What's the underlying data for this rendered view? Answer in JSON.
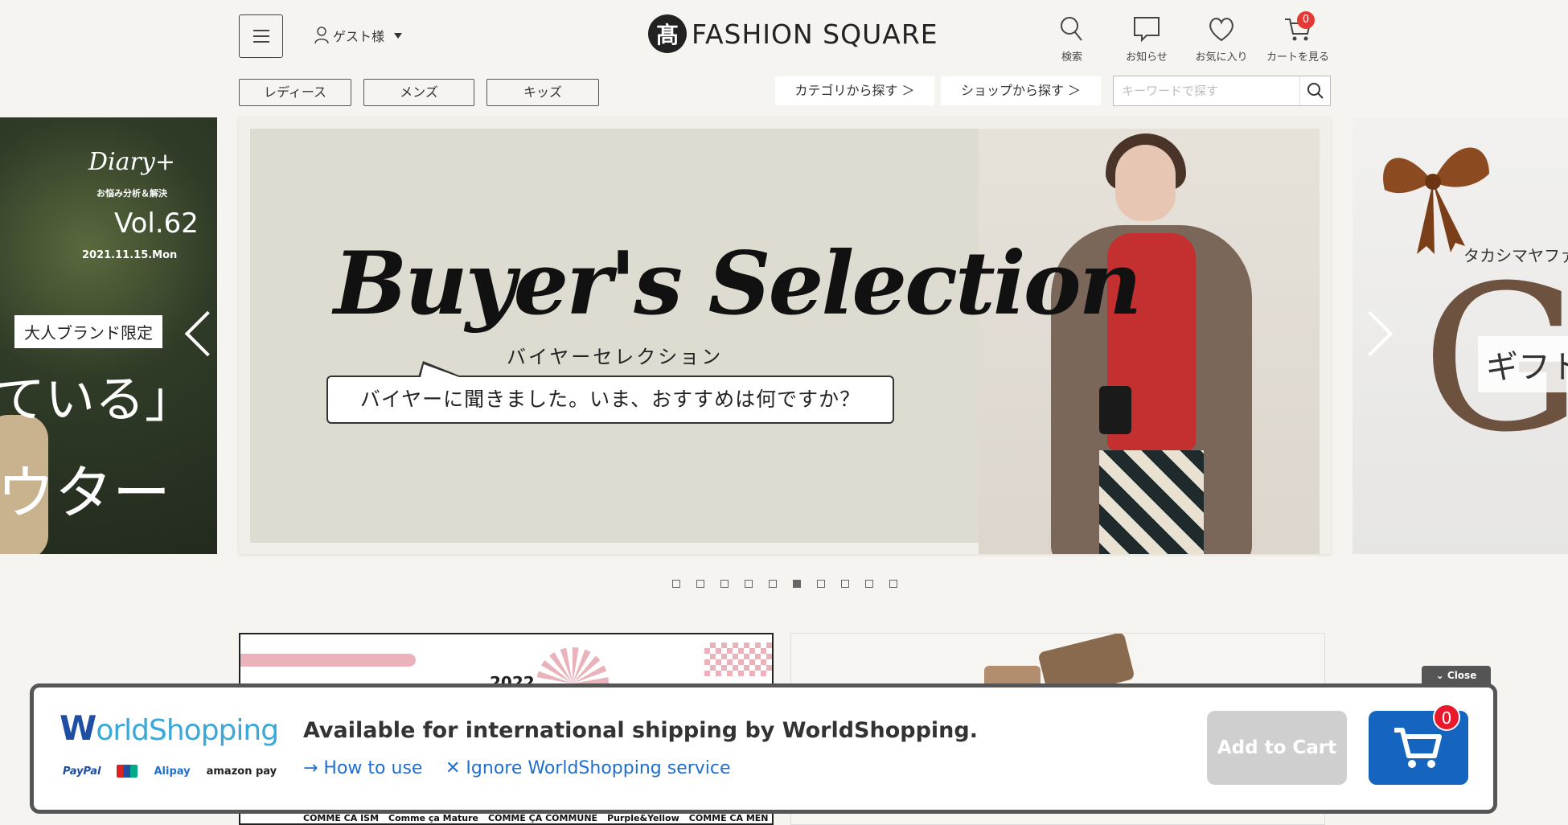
{
  "header": {
    "guest_label": "ゲスト様",
    "logo_mark": "髙",
    "logo_text": "FASHION SQUARE",
    "icons": [
      {
        "label": "検索",
        "icon": "search-icon"
      },
      {
        "label": "お知らせ",
        "icon": "chat-icon"
      },
      {
        "label": "お気に入り",
        "icon": "heart-icon"
      },
      {
        "label": "カートを見る",
        "icon": "cart-icon"
      }
    ],
    "cart_count": "0"
  },
  "nav": {
    "categories": [
      "レディース",
      "メンズ",
      "キッズ"
    ],
    "find_by_category": "カテゴリから探す ＞",
    "find_by_shop": "ショップから探す ＞",
    "search_placeholder": "キーワードで探す"
  },
  "carousel": {
    "left_slide": {
      "brand": "Diary+",
      "brand_top": "大人",
      "subtitle": "お悩み分析＆解決",
      "vol": "Vol.62",
      "date": "2021.11.15.Mon",
      "tag": "大人ブランド限定",
      "line1": "ている」",
      "line2": "ウター"
    },
    "main_slide": {
      "title": "Buyer's Selection",
      "kana": "バイヤーセレクション",
      "bubble": "バイヤーに聞きました。いま、おすすめは何ですか？"
    },
    "right_slide": {
      "text": "タカシマヤファ",
      "letter": "G",
      "gift": "ギフト"
    },
    "dot_count": 10,
    "active_dot": 6
  },
  "banners": {
    "a_year": "2022",
    "a_brands": [
      "COMME CA ISM",
      "Comme ça Mature",
      "COMME ÇA COMMUNE",
      "Purple&Yellow",
      "COMME CA MEN"
    ]
  },
  "worldshopping": {
    "close_label": "Close",
    "logo_w": "W",
    "logo_rest": "orldShopping",
    "pay": [
      "PayPal",
      "Alipay",
      "amazon pay"
    ],
    "headline": "Available for international shipping by WorldShopping.",
    "how_to_use": "→ How to use",
    "ignore": "✕ Ignore WorldShopping service",
    "add_to_cart": "Add to Cart",
    "cart_count": "0"
  }
}
